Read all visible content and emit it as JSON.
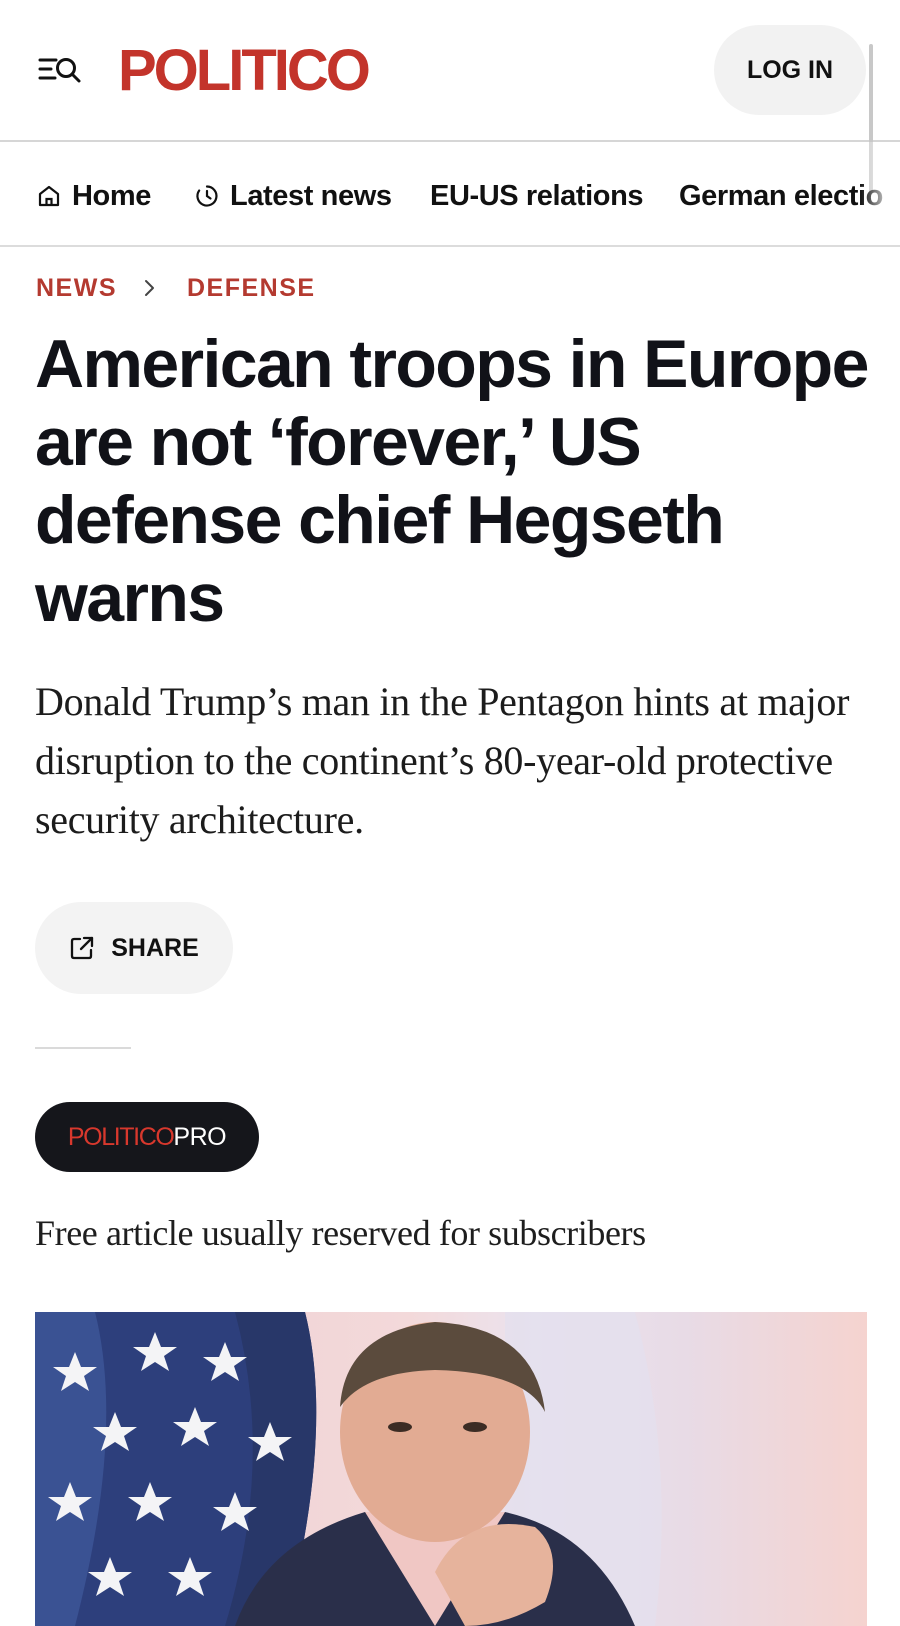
{
  "header": {
    "logo_text": "POLITICO",
    "login_label": "LOG IN",
    "menu_icon": "menu-search-icon"
  },
  "nav": {
    "items": [
      {
        "label": "Home",
        "icon": "home-icon"
      },
      {
        "label": "Latest news",
        "icon": "clock-icon"
      },
      {
        "label": "EU-US relations"
      },
      {
        "label": "German electio"
      }
    ]
  },
  "breadcrumb": {
    "section": "NEWS",
    "subsection": "DEFENSE"
  },
  "article": {
    "headline": "American troops in Europe are not ‘forever,’ US defense chief Hegseth warns",
    "dek": "Donald Trump’s man in the Pentagon hints at major disruption to the continent’s 80-year-old protective security architecture.",
    "share_label": "SHARE",
    "pro_badge": {
      "part1": "POLITICO",
      "part2": "PRO"
    },
    "free_note": "Free article usually reserved for subscribers"
  },
  "colors": {
    "brand_red": "#c3342b",
    "crumb_red": "#b43a30",
    "text_dark": "#111218",
    "badge_bg": "#15161b"
  }
}
